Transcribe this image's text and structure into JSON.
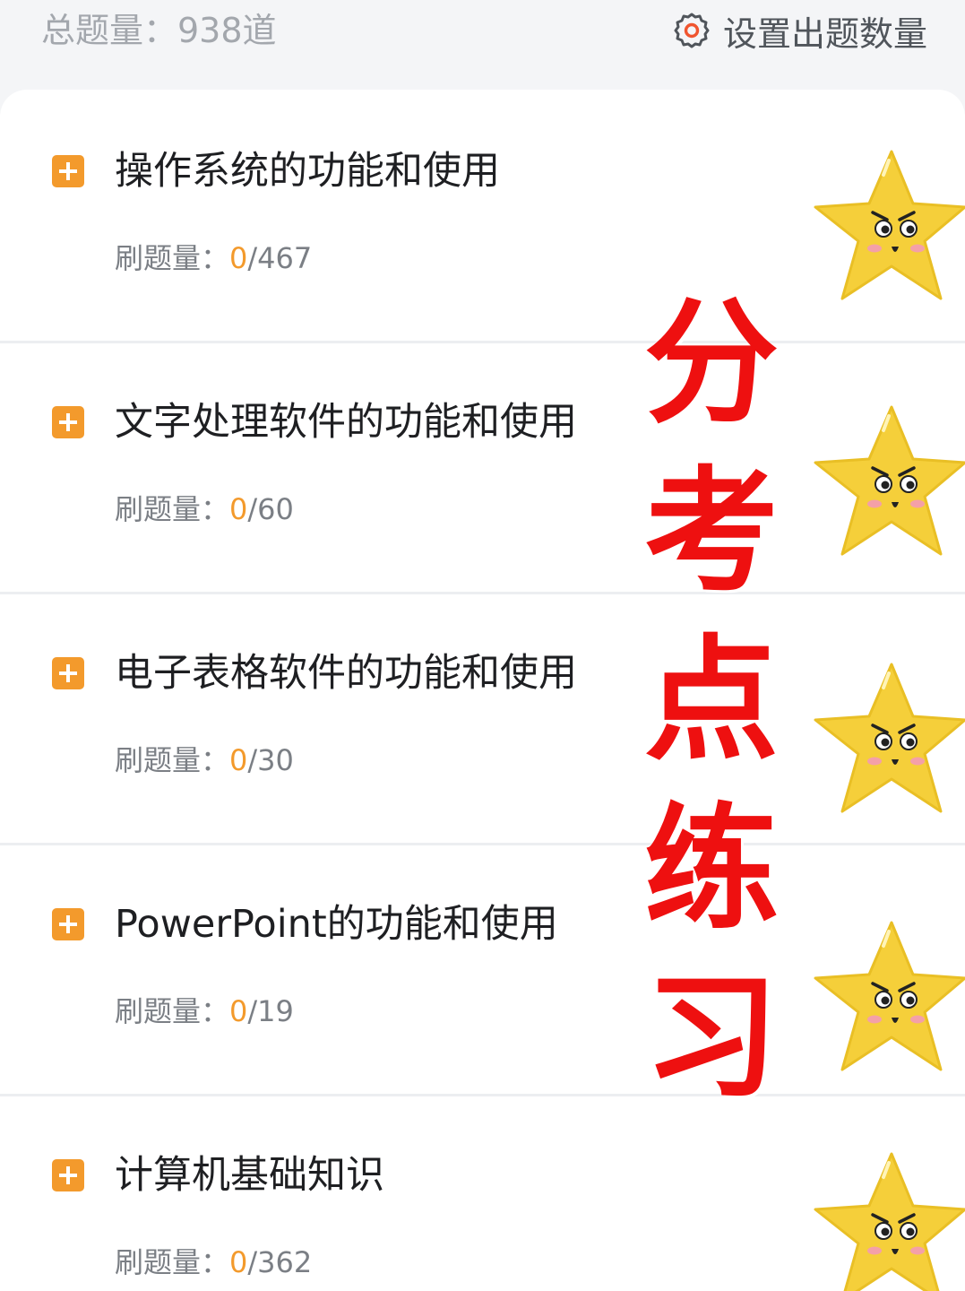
{
  "header": {
    "total_label": "总题量：938道",
    "settings_label": "设置出题数量"
  },
  "sections": [
    {
      "title": "操作系统的功能和使用",
      "progress_label": "刷题量：",
      "done": "0",
      "total": "/467"
    },
    {
      "title": "文字处理软件的功能和使用",
      "progress_label": "刷题量：",
      "done": "0",
      "total": "/60"
    },
    {
      "title": "电子表格软件的功能和使用",
      "progress_label": "刷题量：",
      "done": "0",
      "total": "/30"
    },
    {
      "title": "PowerPoint的功能和使用",
      "progress_label": "刷题量：",
      "done": "0",
      "total": "/19"
    },
    {
      "title": "计算机基础知识",
      "progress_label": "刷题量：",
      "done": "0",
      "total": "/362"
    }
  ],
  "overlay": {
    "chars": [
      "分",
      "考",
      "点",
      "练",
      "习"
    ]
  },
  "colors": {
    "accent": "#f39a2c",
    "overlay_red": "#ee1010",
    "star_yellow": "#f5cf3a"
  },
  "icons": {
    "settings": "gear-icon",
    "expand": "plus-square-icon",
    "decoration": "star-face-icon"
  }
}
